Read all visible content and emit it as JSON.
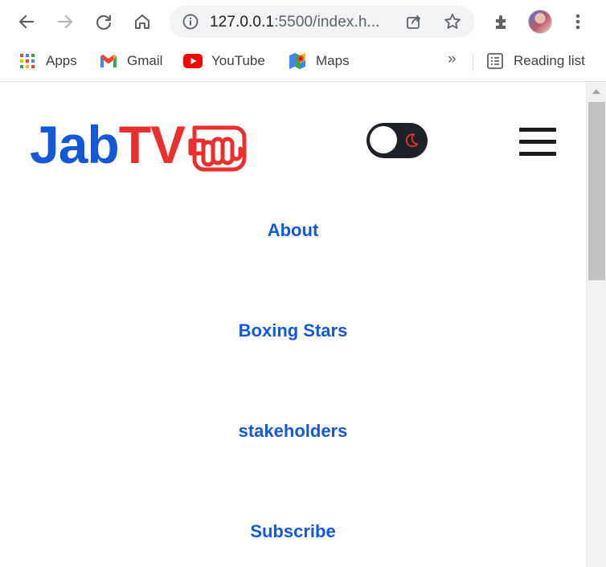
{
  "browser": {
    "url_host": "127.0.0.1",
    "url_rest": ":5500/index.h...",
    "bookmarks": [
      {
        "label": "Apps",
        "icon": "apps-grid-icon"
      },
      {
        "label": "Gmail",
        "icon": "gmail-icon"
      },
      {
        "label": "YouTube",
        "icon": "youtube-icon"
      },
      {
        "label": "Maps",
        "icon": "maps-icon"
      }
    ],
    "overflow_label": "»",
    "reading_list_label": "Reading list"
  },
  "page": {
    "logo_part1": "Jab",
    "logo_part2": "TV",
    "theme_toggle": {
      "state": "dark-mode",
      "icon": "moon-icon"
    },
    "nav_links": [
      "About",
      "Boxing Stars",
      "stakeholders",
      "Subscribe"
    ]
  },
  "colors": {
    "brand_blue": "#1558d6",
    "brand_red": "#e8312f",
    "toggle_bg": "#1f2128"
  }
}
